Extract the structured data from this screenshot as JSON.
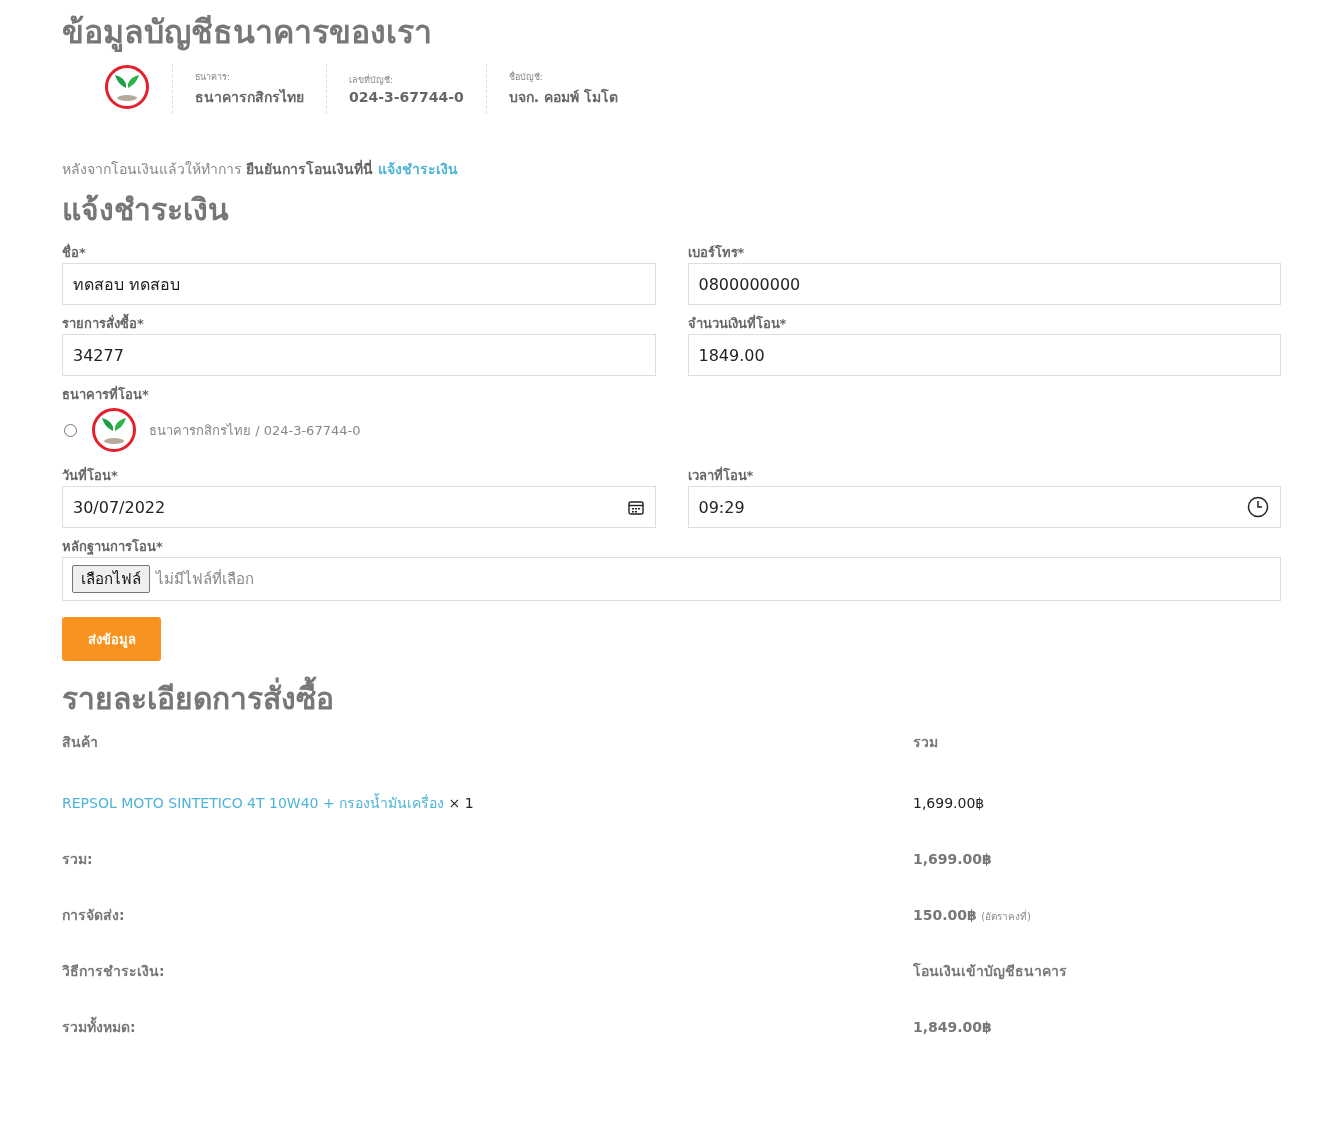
{
  "bank_info": {
    "title": "ข้อมูลบัญชีธนาคารของเรา",
    "fields": [
      {
        "label": "ธนาคาร:",
        "value": "ธนาคารกสิกรไทย"
      },
      {
        "label": "เลขที่บัญชี:",
        "value": "024-3-67744-0"
      },
      {
        "label": "ชื่อบัญชี:",
        "value": "บจก. คอมพ์ โมโต"
      }
    ]
  },
  "notice": {
    "text": "หลังจากโอนเงินแล้วให้ทำการ **ยืนยันการโอนเงินที่นี่**",
    "link": "แจ้งชำระเงิน"
  },
  "payment_form": {
    "title": "แจ้งชำระเงิน",
    "rows": [
      [
        {
          "kind": "text",
          "label": "ชื่อ*",
          "value": "ทดสอบ ทดสอบ"
        },
        {
          "kind": "text",
          "label": "เบอร์โทร*",
          "value": "0800000000"
        }
      ],
      [
        {
          "kind": "text",
          "label": "รายการสั่งซื้อ*",
          "value": "34277"
        },
        {
          "kind": "text",
          "label": "จำนวนเงินที่โอน*",
          "value": "1849.00"
        }
      ]
    ],
    "bank_choice": {
      "label": "ธนาคารที่โอน*",
      "options": [
        {
          "text": "ธนาคารกสิกรไทย / 024-3-67744-0",
          "selected": false
        }
      ]
    },
    "rows2": [
      [
        {
          "kind": "date",
          "label": "วันที่โอน*",
          "value": "30/07/2022"
        },
        {
          "kind": "time",
          "label": "เวลาที่โอน*",
          "value": "09:29"
        }
      ]
    ],
    "proof": {
      "label": "หลักฐานการโอน*",
      "button": "เลือกไฟล์",
      "status": "ไม่มีไฟล์ที่เลือก"
    },
    "submit": "ส่งข้อมูล"
  },
  "order": {
    "title": "รายละเอียดการสั่งซื้อ",
    "columns": [
      "สินค้า",
      "รวม"
    ],
    "rows": [
      {
        "kind": "product",
        "name": "REPSOL MOTO SINTETICO 4T 10W40 + กรองน้ำมันเครื่อง",
        "qty": "× 1",
        "value": "1,699.00฿"
      },
      {
        "kind": "total",
        "label": "รวม:",
        "value": "1,699.00฿"
      },
      {
        "kind": "total",
        "label": "การจัดส่ง:",
        "value": "150.00฿",
        "note": "(อัตราคงที่)"
      },
      {
        "kind": "total",
        "label": "วิธีการชำระเงิน:",
        "value": "โอนเงินเข้าบัญชีธนาคาร"
      },
      {
        "kind": "total",
        "label": "รวมทั้งหมด:",
        "value": "1,849.00฿"
      }
    ]
  }
}
